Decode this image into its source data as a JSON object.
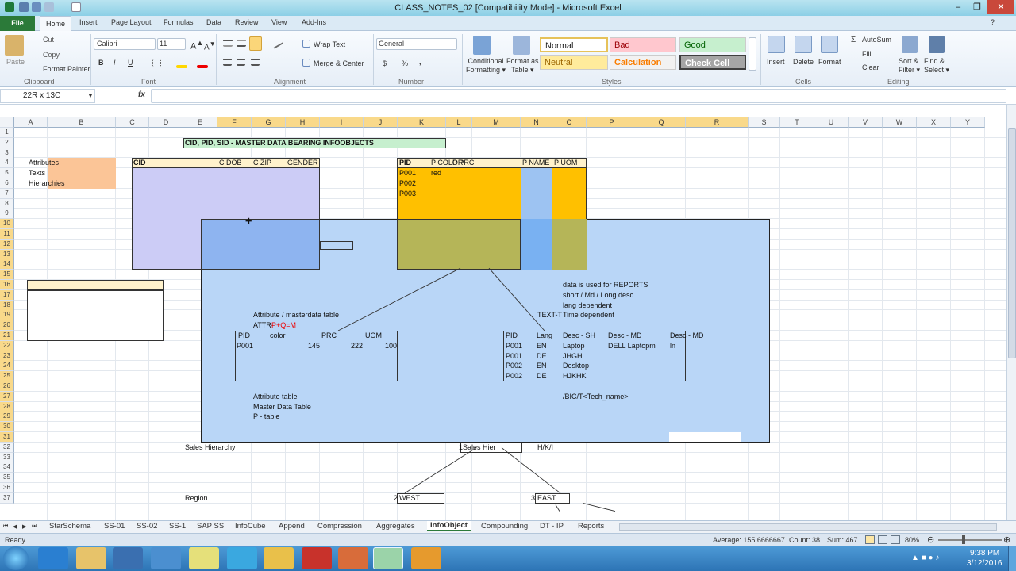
{
  "window": {
    "title": "CLASS_NOTES_02  [Compatibility Mode]  -  Microsoft Excel"
  },
  "tabs": {
    "file": "File",
    "home": "Home",
    "insert": "Insert",
    "page_layout": "Page Layout",
    "formulas": "Formulas",
    "data": "Data",
    "review": "Review",
    "view": "View",
    "addins": "Add-Ins"
  },
  "ribbon": {
    "clipboard": {
      "paste": "Paste",
      "cut": "Cut",
      "copy": "Copy",
      "format_painter": "Format Painter",
      "group": "Clipboard"
    },
    "font": {
      "name": "Calibri",
      "size": "11",
      "bold": "B",
      "italic": "I",
      "underline": "U",
      "group": "Font"
    },
    "alignment": {
      "wrap": "Wrap Text",
      "merge": "Merge & Center",
      "group": "Alignment"
    },
    "number": {
      "format": "General",
      "currency": "$",
      "percent": "%",
      "comma": ",",
      "group": "Number"
    },
    "styles": {
      "conditional": "Conditional\nFormatting",
      "format_table": "Format as\nTable",
      "normal": "Normal",
      "bad": "Bad",
      "good": "Good",
      "neutral": "Neutral",
      "calculation": "Calculation",
      "check_cell": "Check Cell",
      "group": "Styles"
    },
    "cells": {
      "insert": "Insert",
      "delete": "Delete",
      "format": "Format",
      "group": "Cells"
    },
    "editing": {
      "autosum": "AutoSum",
      "fill": "Fill",
      "clear": "Clear",
      "sort": "Sort &\nFilter",
      "find": "Find &\nSelect",
      "group": "Editing"
    }
  },
  "formula_bar": {
    "name_box": "22R x 13C",
    "fx": "fx",
    "value": ""
  },
  "columns": [
    "A",
    "B",
    "C",
    "D",
    "E",
    "F",
    "G",
    "H",
    "I",
    "J",
    "K",
    "L",
    "M",
    "N",
    "O",
    "P",
    "Q",
    "R",
    "S",
    "T",
    "U",
    "V",
    "W",
    "X",
    "Y"
  ],
  "rows": [
    "1",
    "2",
    "3",
    "4",
    "5",
    "6",
    "7",
    "8",
    "9",
    "10",
    "11",
    "12",
    "13",
    "14",
    "15",
    "16",
    "17",
    "18",
    "19",
    "20",
    "21",
    "22",
    "23",
    "24",
    "25",
    "26",
    "27",
    "28",
    "29",
    "30",
    "31",
    "32",
    "33",
    "34",
    "35",
    "36",
    "37"
  ],
  "cells": {
    "banner": "CID, PID, SID - MASTER DATA BEARING INFOOBJECTS",
    "attributes": "Attributes",
    "texts": "Texts",
    "hierarchies": "Hierarchies",
    "cid": "CID",
    "cdob": "C DOB",
    "czip": "C ZIP",
    "gender": "GENDER",
    "pid": "PID",
    "pcolor": "P COLOR",
    "pprc": "P PRC",
    "pname": "P NAME",
    "puom": "P UOM",
    "p001": "P001",
    "red": "red",
    "p002": "P002",
    "p003": "P003",
    "attr_master": "Attribute / masterdata table",
    "attr_formula_a": "ATTR-",
    "attr_formula_b": "P+Q=M",
    "rep1": "data is used for REPORTS",
    "rep2": "short / Md / Long desc",
    "rep3": "lang dependent",
    "textt": "TEXT-T",
    "rep4": "Time dependent",
    "t1_pid": "PID",
    "t1_color": "color",
    "t1_prc": "PRC",
    "t1_uom": "UOM",
    "t1_p001": "P001",
    "t1_145": "145",
    "t1_222": "222",
    "t1_100": "100",
    "t2_pid": "PID",
    "t2_lang": "Lang",
    "t2_descsh": "Desc - SH",
    "t2_descmd": "Desc - MD",
    "t2_descmd2": "Desc - MD",
    "t2_r1": [
      "P001",
      "EN",
      "Laptop",
      "DELL Laptopm",
      "ln"
    ],
    "t2_r2": [
      "P001",
      "DE",
      "JHGH"
    ],
    "t2_r3": [
      "P002",
      "EN",
      "Desktop"
    ],
    "t2_r4": [
      "P002",
      "DE",
      "HJKHK"
    ],
    "attr_table": "Attribute table",
    "mdt": "Master Data Table",
    "ptable": "P - table",
    "bic": "/BIC/T<Tech_name>",
    "sales_hier": "Sales Hierarchy",
    "one": "1",
    "sales_hier_box": "Sales Hier",
    "hki": "H/K/I",
    "region": "Region",
    "two": "2",
    "west": "WEST",
    "three": "3",
    "east": "EAST"
  },
  "sheets": [
    "StarSchema",
    "SS-01",
    "SS-02",
    "SS-1",
    "SAP SS",
    "InfoCube",
    "Append",
    "Compression",
    "Aggregates",
    "InfoObject",
    "Compounding",
    "DT - IP",
    "Reports"
  ],
  "active_sheet": "InfoObject",
  "status": {
    "ready": "Ready",
    "average": "Average: 155.6666667",
    "count": "Count: 38",
    "sum": "Sum: 467",
    "zoom": "80%"
  },
  "clock": {
    "time": "9:38 PM",
    "date": "3/12/2016"
  }
}
